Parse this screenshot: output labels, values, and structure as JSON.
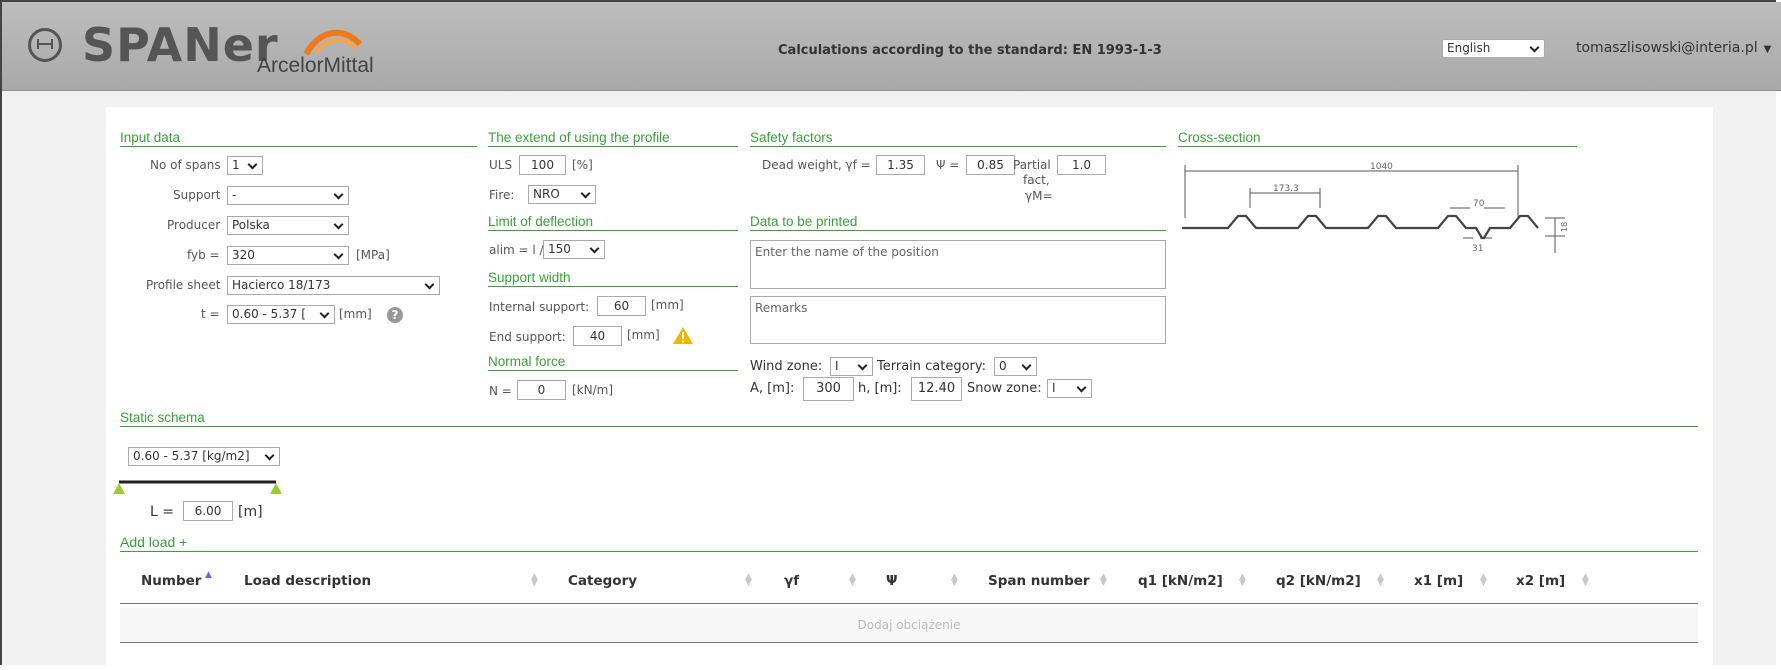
{
  "header": {
    "brand": "SPANer",
    "partner": "ArcelorMittal",
    "title": "Calculations according to the standard: EN 1993-1-3",
    "language": "English",
    "user": "tomaszlisowski@interia.pl"
  },
  "input_data": {
    "heading": "Input data",
    "spans_label": "No of spans",
    "spans_value": "1",
    "support_label": "Support",
    "support_value": "-",
    "producer_label": "Producer",
    "producer_value": "Polska",
    "fyb_label": "fyb =",
    "fyb_value": "320",
    "fyb_unit": "[MPa]",
    "profile_label": "Profile sheet",
    "profile_value": "Hacierco 18/173",
    "t_label": "t =",
    "t_value": "0.60 - 5.37 [",
    "t_unit": "[mm]"
  },
  "extend": {
    "heading": "The extend of using the profile",
    "uls_label": "ULS",
    "uls_value": "100",
    "uls_unit": "[%]",
    "fire_label": "Fire:",
    "fire_value": "NRO"
  },
  "deflection": {
    "heading": "Limit of deflection",
    "label": "alim = l /",
    "value": "150"
  },
  "support_width": {
    "heading": "Support width",
    "internal_label": "Internal support:",
    "internal_value": "60",
    "end_label": "End support:",
    "end_value": "40",
    "unit": "[mm]"
  },
  "normal_force": {
    "heading": "Normal force",
    "label": "N =",
    "value": "0",
    "unit": "[kN/m]"
  },
  "safety": {
    "heading": "Safety factors",
    "dead_weight_label": "Dead weight, γf =",
    "dead_weight_value": "1.35",
    "psi_label": "Ψ =",
    "psi_value": "0.85",
    "partial_label_1": "Partial",
    "partial_label_2": "fact,",
    "partial_label_3": "γM=",
    "partial_value": "1.0"
  },
  "print_data": {
    "heading": "Data to be printed",
    "position_placeholder": "Enter the name of the position",
    "remarks_placeholder": "Remarks"
  },
  "environment": {
    "wind_label": "Wind zone:",
    "wind_value": "I",
    "terrain_label": "Terrain category:",
    "terrain_value": "0",
    "a_label": "A, [m]:",
    "a_value": "300",
    "h_label": "h, [m]:",
    "h_value": "12.40",
    "snow_label": "Snow zone:",
    "snow_value": "I"
  },
  "cross_section": {
    "heading": "Cross-section",
    "dim_width": "1040",
    "dim_pitch": "173.3",
    "dim_rib_top": "70",
    "dim_rib_bottom": "31",
    "dim_height": "18"
  },
  "static_schema": {
    "heading": "Static schema",
    "load_select": "0.60 - 5.37 [kg/m2]",
    "l_label": "L =",
    "l_value": "6.00",
    "l_unit": "[m]",
    "add_load": "Add load +"
  },
  "table": {
    "columns": [
      "Number",
      "Load description",
      "Category",
      "γf",
      "Ψ",
      "Span number",
      "q1 [kN/m2]",
      "q2 [kN/m2]",
      "x1 [m]",
      "x2 [m]"
    ],
    "empty_text": "Dodaj obciążenie"
  },
  "colors": {
    "accent": "#3aa03a",
    "header_bg": "#afafaf",
    "warning": "#f5b400"
  }
}
